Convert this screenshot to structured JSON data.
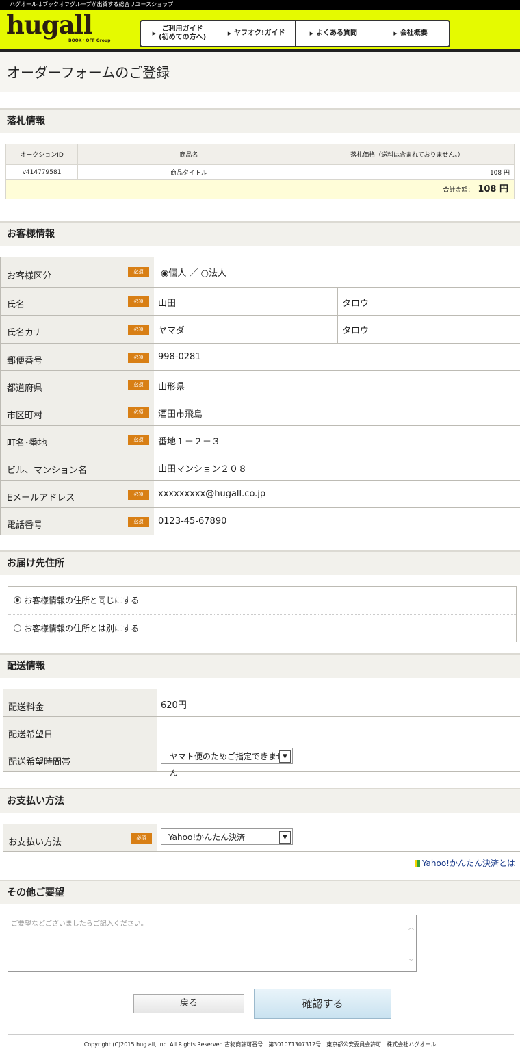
{
  "tagline": "ハグオールはブックオフグループが出資する総合リユースショップ",
  "logo": {
    "text": "hugall",
    "sub": "BOOK・OFF Group"
  },
  "nav": [
    {
      "label": "ご利用ガイド\n(初めての方へ)"
    },
    {
      "label": "ヤフオク!ガイド"
    },
    {
      "label": "よくある質問"
    },
    {
      "label": "会社概要"
    }
  ],
  "page_title": "オーダーフォームのご登録",
  "sections": {
    "bid": "落札情報",
    "customer": "お客様情報",
    "delivery_address": "お届け先住所",
    "shipping": "配送情報",
    "payment": "お支払い方法",
    "other": "その他ご要望"
  },
  "bid_table": {
    "headers": [
      "オークションID",
      "商品名",
      "落札価格（送料は含まれておりません。）"
    ],
    "row": [
      "v414779581",
      "商品タイトル",
      "108 円"
    ],
    "total_label": "合計金額：",
    "total_value": "108 円"
  },
  "required": "必須",
  "customer": {
    "type_label": "お客様区分",
    "type_value": "◉個人 ／ ○法人",
    "name_label": "氏名",
    "name_last": "山田",
    "name_first": "タロウ",
    "kana_label": "氏名カナ",
    "kana_last": "ヤマダ",
    "kana_first": "タロウ",
    "zip_label": "郵便番号",
    "zip": "998-0281",
    "pref_label": "都道府県",
    "pref": "山形県",
    "city_label": "市区町村",
    "city": "酒田市飛島",
    "street_label": "町名･番地",
    "street": "番地１－２－３",
    "building_label": "ビル、マンション名",
    "building": "山田マンション２０８",
    "email_label": "Eメールアドレス",
    "email": "xxxxxxxxx@hugall.co.jp",
    "phone_label": "電話番号",
    "phone": "0123-45-67890"
  },
  "delivery_address": {
    "same": "お客様情報の住所と同じにする",
    "different": "お客様情報の住所とは別にする"
  },
  "shipping": {
    "fee_label": "配送料金",
    "fee": "620円",
    "date_label": "配送希望日",
    "time_label": "配送希望時間帯",
    "time_value": "ヤマト便のためご指定できません"
  },
  "payment": {
    "label": "お支払い方法",
    "value": "Yahoo!かんたん決済",
    "link": "Yahoo!かんたん決済とは"
  },
  "other": {
    "placeholder": "ご要望などございましたらご記入ください。"
  },
  "buttons": {
    "back": "戻る",
    "confirm": "確認する"
  },
  "footer": "Copyright (C)2015 hug all, Inc. All Rights Reserved.古物商許可番号　第301071307312号　東京都公安委員会許可　株式会社ハグオール",
  "colors": {
    "header": "#e5fa00",
    "required_badge": "#d87f15",
    "total_bg": "#fffdd8"
  }
}
